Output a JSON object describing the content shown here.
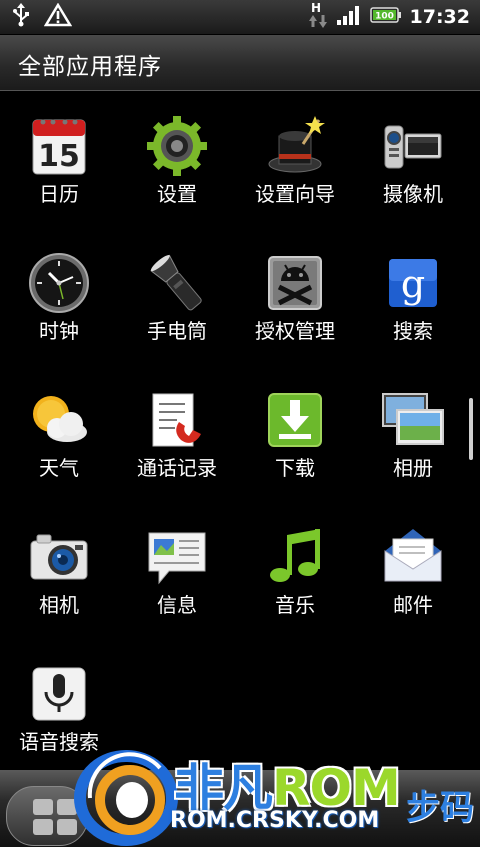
{
  "status_bar": {
    "time": "17:32",
    "battery_level": "100",
    "network_type": "H",
    "icons": [
      "usb-icon",
      "warning-icon",
      "data-arrows-icon",
      "signal-icon",
      "battery-icon"
    ]
  },
  "header": {
    "title": "全部应用程序"
  },
  "apps": [
    {
      "label": "日历",
      "icon": "calendar-icon",
      "day": "15"
    },
    {
      "label": "设置",
      "icon": "settings-gear-icon"
    },
    {
      "label": "设置向导",
      "icon": "setup-wizard-hat-icon"
    },
    {
      "label": "摄像机",
      "icon": "camcorder-icon"
    },
    {
      "label": "时钟",
      "icon": "clock-icon"
    },
    {
      "label": "手电筒",
      "icon": "flashlight-icon"
    },
    {
      "label": "授权管理",
      "icon": "superuser-android-icon"
    },
    {
      "label": "搜索",
      "icon": "google-search-icon",
      "glyph": "g"
    },
    {
      "label": "天气",
      "icon": "weather-icon"
    },
    {
      "label": "通话记录",
      "icon": "call-log-icon"
    },
    {
      "label": "下载",
      "icon": "download-icon"
    },
    {
      "label": "相册",
      "icon": "gallery-icon"
    },
    {
      "label": "相机",
      "icon": "camera-icon"
    },
    {
      "label": "信息",
      "icon": "messages-icon"
    },
    {
      "label": "音乐",
      "icon": "music-note-icon"
    },
    {
      "label": "邮件",
      "icon": "mail-envelope-icon"
    },
    {
      "label": "语音搜索",
      "icon": "voice-search-mic-icon"
    }
  ],
  "watermark": {
    "brand_part1": "非凡",
    "brand_part2": "ROM",
    "url": "ROM.CRSKY.COM",
    "side_text": "步码"
  },
  "colors": {
    "accent_blue": "#2d7fe0",
    "accent_green": "#9bd82b",
    "background": "#000000"
  }
}
